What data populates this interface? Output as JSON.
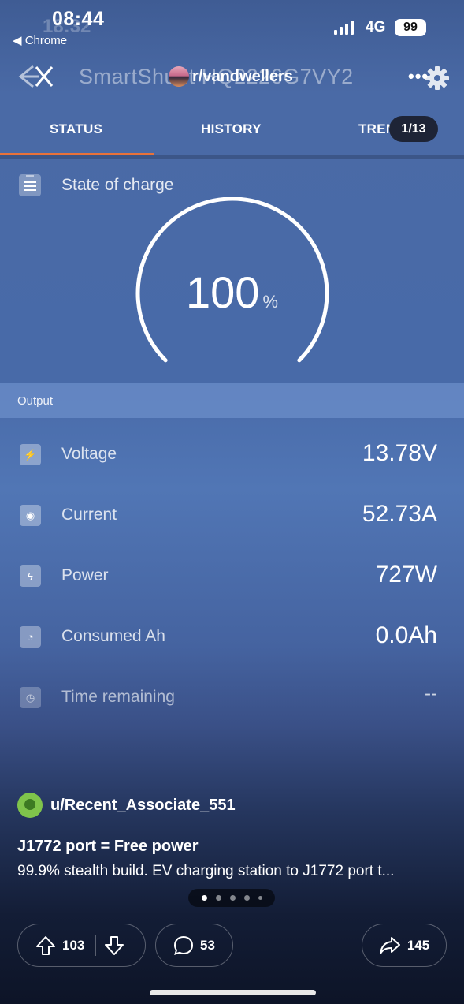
{
  "status_bar": {
    "time": "08:44",
    "ghost_time": "18:32",
    "back_app": "◀ Chrome",
    "network": "4G",
    "battery": "99"
  },
  "header": {
    "title": "SmartShunt HQ2226G7VY2",
    "subreddit": "r/vandwellers",
    "more_label": "•••"
  },
  "tabs": [
    {
      "label": "STATUS",
      "active": true
    },
    {
      "label": "HISTORY",
      "active": false
    },
    {
      "label": "TRENDS",
      "active": false
    }
  ],
  "pager": "1/13",
  "state_of_charge": {
    "label": "State of charge",
    "value": "100",
    "unit": "%",
    "fraction": 1.0
  },
  "output": {
    "section_label": "Output",
    "rows": [
      {
        "label": "Voltage",
        "value": "13.78V",
        "icon": "voltage-icon"
      },
      {
        "label": "Current",
        "value": "52.73A",
        "icon": "current-icon"
      },
      {
        "label": "Power",
        "value": "727W",
        "icon": "power-icon"
      },
      {
        "label": "Consumed Ah",
        "value": "0.0Ah",
        "icon": "consumed-icon"
      },
      {
        "label": "Time remaining",
        "value": "--",
        "icon": "clock-icon"
      }
    ]
  },
  "post": {
    "username": "u/Recent_Associate_551",
    "title": "J1772 port = Free power",
    "body": "99.9% stealth build. EV charging station to J1772 port t...",
    "image_index": 1,
    "image_count": 5
  },
  "actions": {
    "upvotes": "103",
    "comments": "53",
    "shares": "145"
  },
  "colors": {
    "tab_accent": "#e8723a",
    "background_top": "#4a6aa6",
    "background_bottom": "#0d1427"
  }
}
